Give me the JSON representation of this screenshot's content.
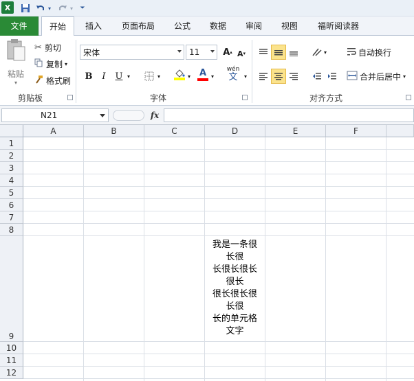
{
  "tabs": [
    {
      "label": "文件"
    },
    {
      "label": "开始"
    },
    {
      "label": "插入"
    },
    {
      "label": "页面布局"
    },
    {
      "label": "公式"
    },
    {
      "label": "数据"
    },
    {
      "label": "审阅"
    },
    {
      "label": "视图"
    },
    {
      "label": "福昕阅读器"
    }
  ],
  "clipboard": {
    "paste": "粘贴",
    "cut": "剪切",
    "copy": "复制",
    "format_painter": "格式刷",
    "group": "剪贴板"
  },
  "font": {
    "name": "宋体",
    "size": "11",
    "bold": "B",
    "italic": "I",
    "underline": "U",
    "font_color_letter": "A",
    "wen": "wén",
    "wen_char": "文",
    "group": "字体"
  },
  "alignment": {
    "wrap_text": "自动换行",
    "merge_center": "合并后居中",
    "group": "对齐方式"
  },
  "formula_bar": {
    "name_box": "N21",
    "fx": "fx"
  },
  "columns": [
    "A",
    "B",
    "C",
    "D",
    "E",
    "F"
  ],
  "rows": [
    "1",
    "2",
    "3",
    "4",
    "5",
    "6",
    "7",
    "8",
    "9",
    "10",
    "11",
    "12"
  ],
  "cell_d9_lines": [
    "我是一条很",
    "长很",
    "长很长很长",
    "很长",
    "很长很长很",
    "长很",
    "长的单元格",
    "文字"
  ],
  "colors": {
    "file_tab": "#2a8a36",
    "highlight": "#fbe38c",
    "fill_yellow": "#ffff00",
    "font_red": "#ff0000"
  }
}
